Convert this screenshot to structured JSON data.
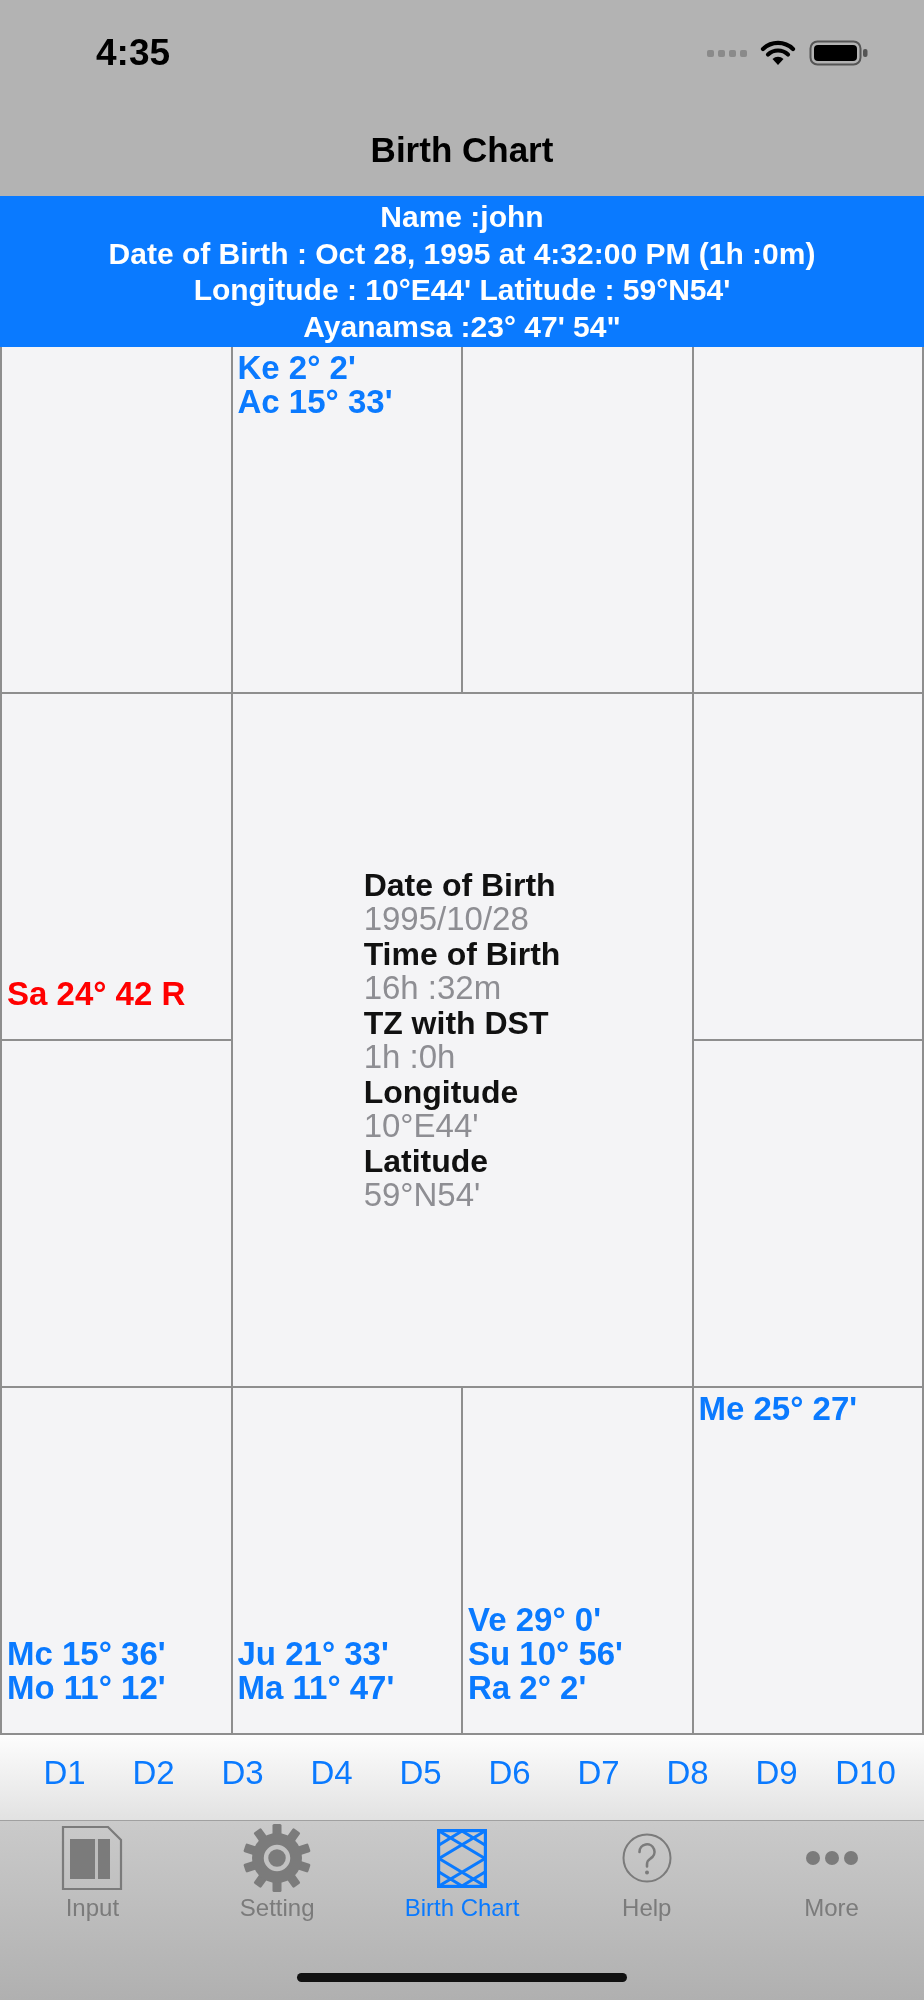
{
  "status_bar": {
    "time": "4:35"
  },
  "navigation_bar": {
    "title": "Birth Chart"
  },
  "banner": {
    "lines": [
      "Name :john",
      "Date of Birth : Oct 28, 1995 at 4:32:00 PM (1h :0m)",
      "Longitude : 10°E44' Latitude : 59°N54'",
      "Ayanamsa :23° 47' 54\""
    ]
  },
  "chart": {
    "houses": {
      "house_2": {
        "planets": [
          {
            "text": "Ke 2° 2'",
            "retrograde": false
          },
          {
            "text": "Ac 15° 33'",
            "retrograde": false
          }
        ]
      },
      "house_5": {
        "planets": [
          {
            "text": "Sa 24° 42 R",
            "retrograde": true
          }
        ]
      },
      "house_9": {
        "planets": [
          {
            "text": "Mc 15° 36'",
            "retrograde": false
          },
          {
            "text": "Mo 11° 12'",
            "retrograde": false
          }
        ]
      },
      "house_10": {
        "planets": [
          {
            "text": "Ju 21° 33'",
            "retrograde": false
          },
          {
            "text": "Ma 11° 47'",
            "retrograde": false
          }
        ]
      },
      "house_11": {
        "planets": [
          {
            "text": "Ve 29° 0'",
            "retrograde": false
          },
          {
            "text": "Su 10° 56'",
            "retrograde": false
          },
          {
            "text": "Ra 2° 2'",
            "retrograde": false
          }
        ]
      },
      "house_12": {
        "planets": [
          {
            "text": "Me 25° 27'",
            "retrograde": false
          }
        ]
      }
    },
    "center": [
      {
        "label": "Date of Birth",
        "value": "1995/10/28"
      },
      {
        "label": "Time of Birth",
        "value": "16h :32m"
      },
      {
        "label": "TZ with DST",
        "value": "1h :0h"
      },
      {
        "label": "Longitude",
        "value": "10°E44'"
      },
      {
        "label": "Latitude",
        "value": "59°N54'"
      }
    ]
  },
  "divisions": [
    "D1",
    "D2",
    "D3",
    "D4",
    "D5",
    "D6",
    "D7",
    "D8",
    "D9",
    "D10"
  ],
  "tab_bar": {
    "tabs": [
      {
        "kind": "input",
        "label": "Input",
        "selected": false
      },
      {
        "kind": "setting",
        "label": "Setting",
        "selected": false
      },
      {
        "kind": "chart",
        "label": "Birth Chart",
        "selected": true
      },
      {
        "kind": "help",
        "label": "Help",
        "selected": false
      },
      {
        "kind": "more",
        "label": "More",
        "selected": false
      }
    ]
  }
}
